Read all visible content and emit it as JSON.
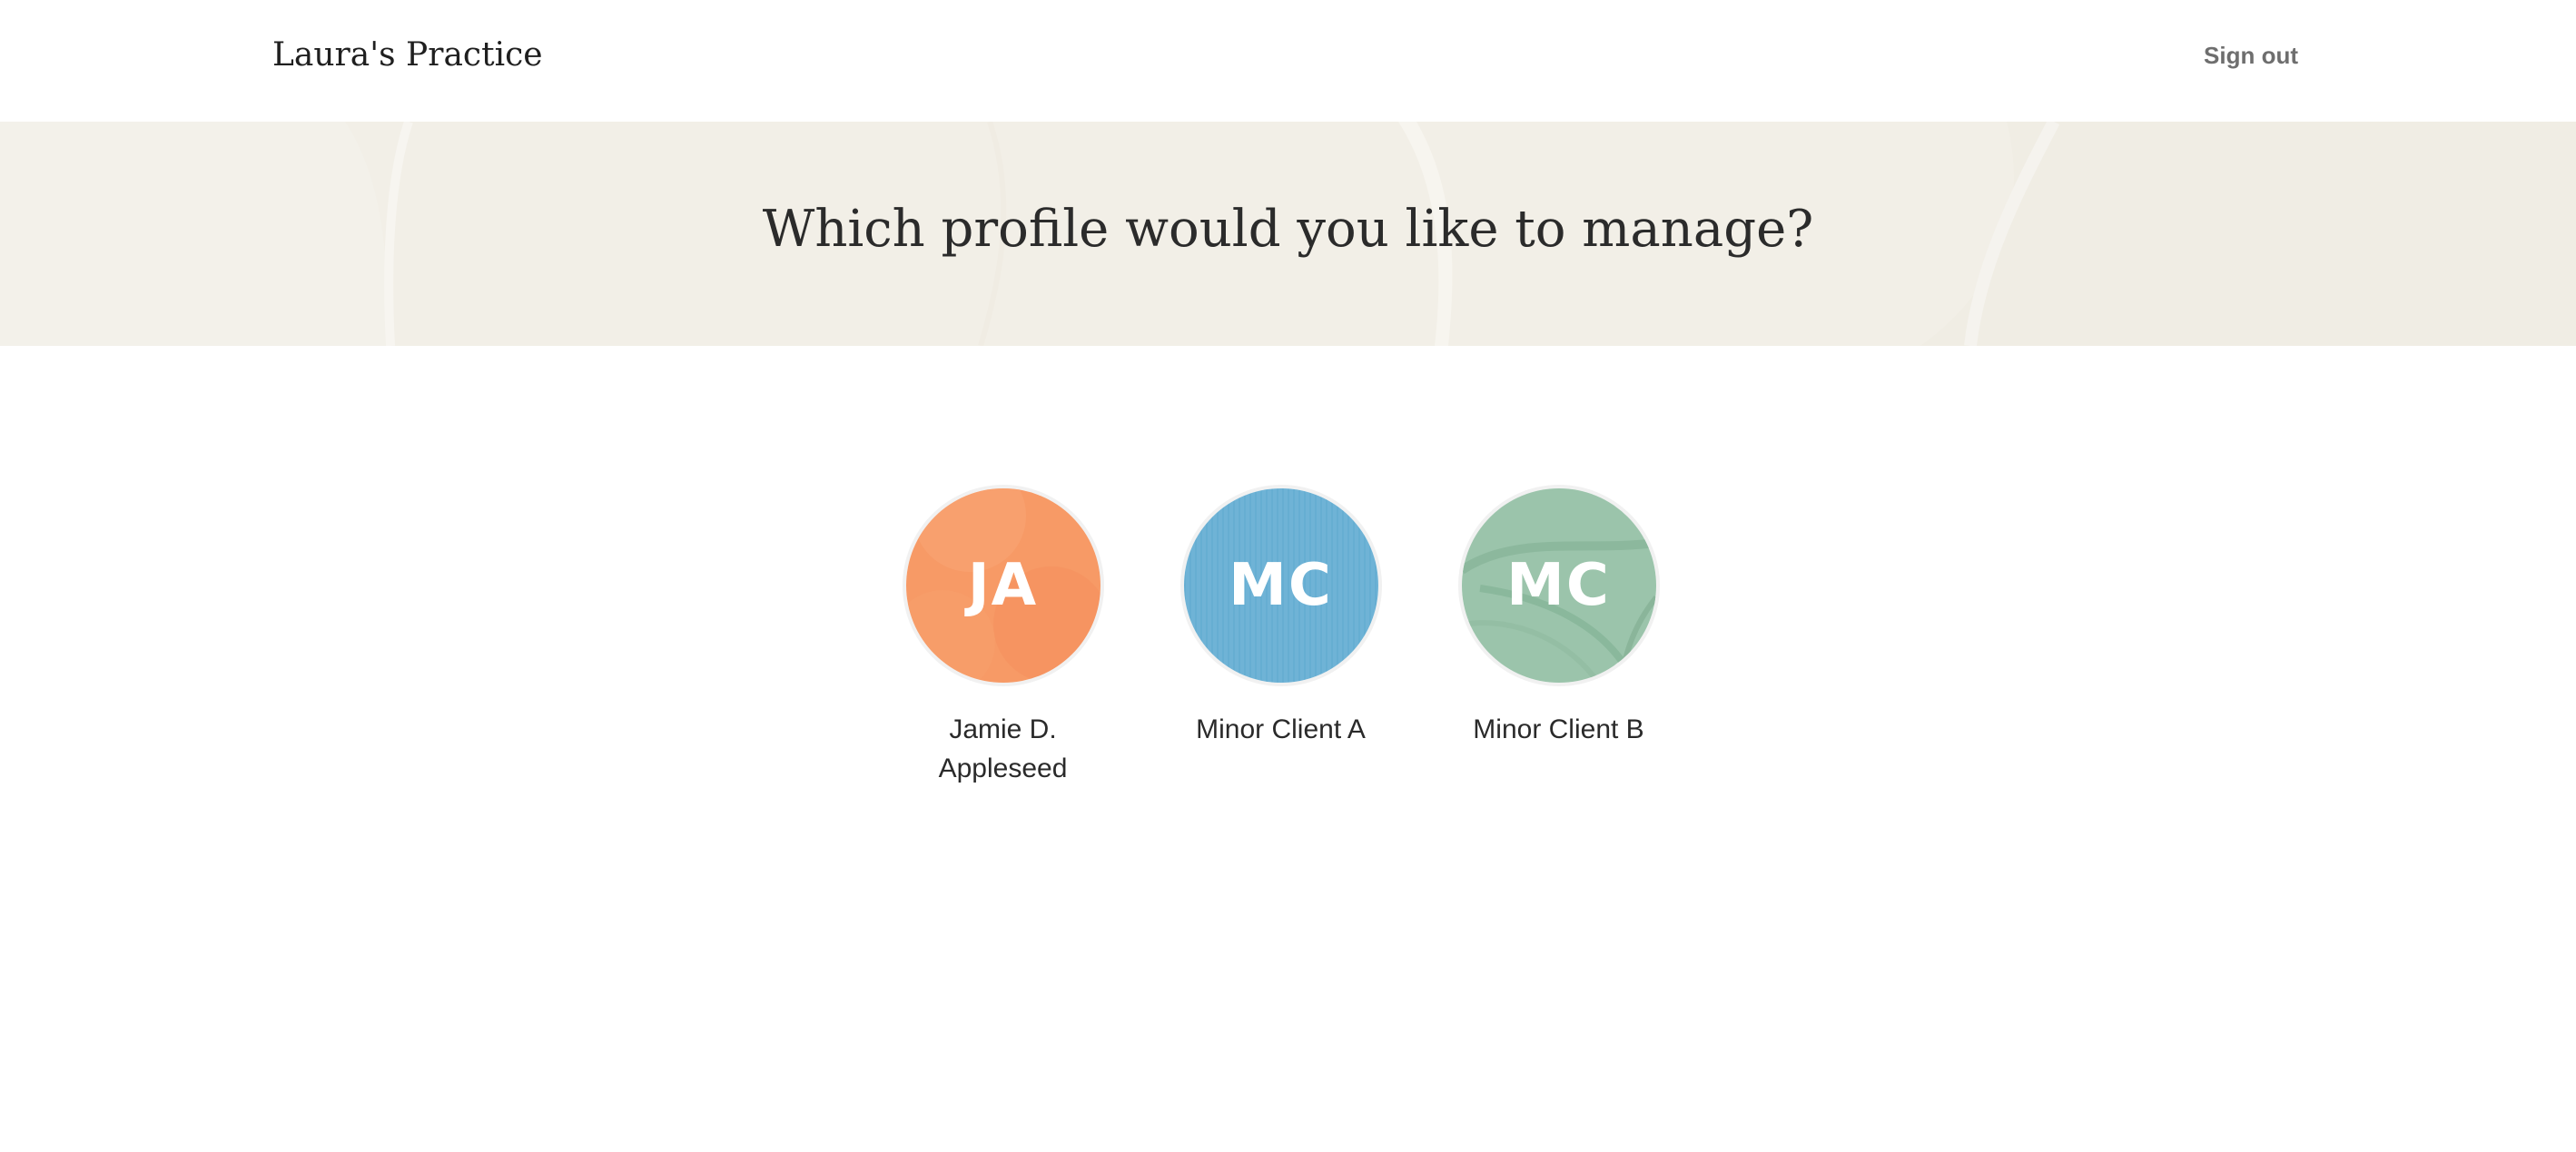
{
  "header": {
    "brand": "Laura's Practice",
    "sign_out_label": "Sign out"
  },
  "hero": {
    "title": "Which profile would you like to manage?"
  },
  "profiles": [
    {
      "initials": "JA",
      "name": "Jamie D. Appleseed",
      "color": "#f79a66",
      "icon": "avatar-ja"
    },
    {
      "initials": "MC",
      "name": "Minor Client A",
      "color": "#6fb3d6",
      "icon": "avatar-mc-a"
    },
    {
      "initials": "MC",
      "name": "Minor Client B",
      "color": "#9bc4ab",
      "icon": "avatar-mc-b"
    }
  ],
  "colors": {
    "hero_background": "#f2efe7",
    "text_dark": "#2b2b2b",
    "sign_out_text": "#6e6e6e"
  }
}
